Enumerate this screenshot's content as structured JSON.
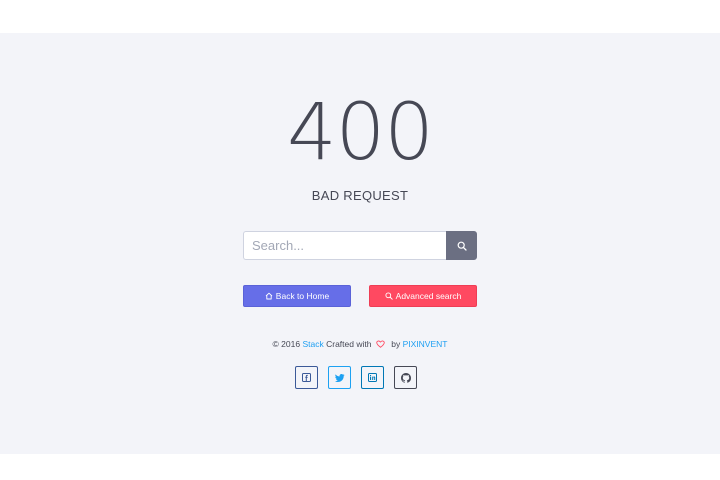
{
  "error": {
    "code": "400",
    "message": "BAD REQUEST"
  },
  "search": {
    "placeholder": "Search...",
    "button_icon": "search-icon"
  },
  "actions": {
    "home_label": "Back to Home",
    "home_icon": "home-icon",
    "advanced_label": "Advanced search",
    "advanced_icon": "search-icon"
  },
  "footer": {
    "copyright": "© 2016",
    "brand": "Stack",
    "crafted": "Crafted with",
    "by": "by",
    "company": "PIXINVENT",
    "heart_icon": "heart-icon"
  },
  "social": [
    {
      "icon": "facebook-icon",
      "color": "#3b5998"
    },
    {
      "icon": "twitter-icon",
      "color": "#1da1f2"
    },
    {
      "icon": "linkedin-icon",
      "color": "#0077b5"
    },
    {
      "icon": "github-icon",
      "color": "#464855"
    }
  ],
  "colors": {
    "primary": "#666ee8",
    "danger": "#ff4961",
    "link": "#1e9ff2",
    "text": "#464855",
    "background": "#f3f4f9",
    "search_button": "#6b6f82"
  }
}
